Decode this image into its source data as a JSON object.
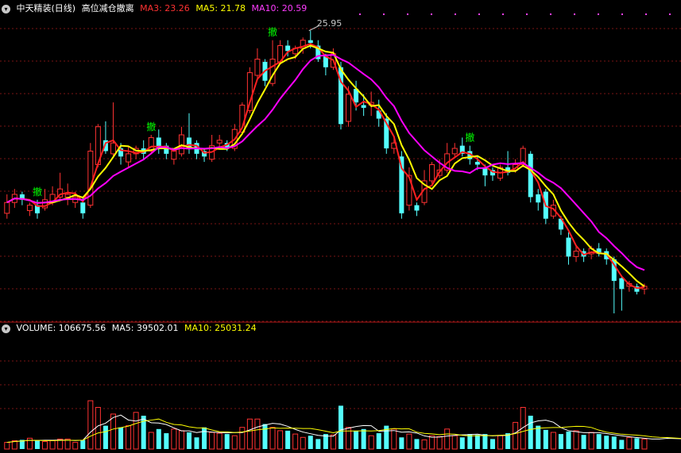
{
  "main_panel": {
    "stock_name": "中天精装(日线)",
    "indicator_name": "高位减仓撤离",
    "ma3_label": "MA3: 23.26",
    "ma5_label": "MA5: 21.78",
    "ma10_label": "MA10: 20.59",
    "high_marker": "25.95",
    "signal_label": "撤"
  },
  "volume_panel": {
    "volume_label": "VOLUME: 106675.56",
    "ma5_label": "MA5: 39502.01",
    "ma10_label": "MA10: 25031.24"
  },
  "colors": {
    "up": "#ff3232",
    "down": "#54ffff",
    "ma3": "#ff2020",
    "ma5": "#ffff00",
    "ma10": "#ff00ff",
    "grid": "#7a1515",
    "signal": "#00ff00",
    "vol_ma": "#ffffff"
  },
  "chart_data": {
    "type": "candlestick",
    "price_ylim": [
      15.5,
      26.5
    ],
    "signal_indices": [
      4,
      19,
      35,
      61
    ],
    "high_marker_index": 40,
    "candles": [
      {
        "o": 19.2,
        "c": 19.6,
        "h": 19.9,
        "l": 19.0
      },
      {
        "o": 19.6,
        "c": 19.9,
        "h": 20.1,
        "l": 19.4
      },
      {
        "o": 19.9,
        "c": 19.7,
        "h": 20.0,
        "l": 19.5
      },
      {
        "o": 19.3,
        "c": 19.5,
        "h": 19.6,
        "l": 19.1
      },
      {
        "o": 19.5,
        "c": 19.2,
        "h": 19.7,
        "l": 19.0
      },
      {
        "o": 19.4,
        "c": 19.7,
        "h": 20.1,
        "l": 19.3
      },
      {
        "o": 19.6,
        "c": 19.9,
        "h": 20.2,
        "l": 19.5
      },
      {
        "o": 19.8,
        "c": 20.1,
        "h": 20.7,
        "l": 19.7
      },
      {
        "o": 19.8,
        "c": 19.9,
        "h": 20.3,
        "l": 19.5
      },
      {
        "o": 19.6,
        "c": 19.8,
        "h": 20.0,
        "l": 19.4
      },
      {
        "o": 19.6,
        "c": 19.2,
        "h": 19.8,
        "l": 19.0
      },
      {
        "o": 19.5,
        "c": 21.5,
        "h": 21.8,
        "l": 19.4
      },
      {
        "o": 21.0,
        "c": 22.4,
        "h": 22.5,
        "l": 20.9
      },
      {
        "o": 21.9,
        "c": 21.5,
        "h": 22.6,
        "l": 21.4
      },
      {
        "o": 21.4,
        "c": 21.8,
        "h": 23.3,
        "l": 21.3
      },
      {
        "o": 21.6,
        "c": 21.3,
        "h": 21.8,
        "l": 21.0
      },
      {
        "o": 21.1,
        "c": 21.4,
        "h": 21.7,
        "l": 20.9
      },
      {
        "o": 21.4,
        "c": 21.6,
        "h": 21.7,
        "l": 21.2
      },
      {
        "o": 21.6,
        "c": 21.4,
        "h": 21.9,
        "l": 21.2
      },
      {
        "o": 21.5,
        "c": 22.0,
        "h": 22.1,
        "l": 21.4
      },
      {
        "o": 22.0,
        "c": 21.6,
        "h": 22.3,
        "l": 21.4
      },
      {
        "o": 21.7,
        "c": 21.4,
        "h": 21.8,
        "l": 21.2
      },
      {
        "o": 21.2,
        "c": 21.5,
        "h": 21.6,
        "l": 21.0
      },
      {
        "o": 21.4,
        "c": 22.1,
        "h": 22.4,
        "l": 21.3
      },
      {
        "o": 22.0,
        "c": 21.6,
        "h": 22.9,
        "l": 21.4
      },
      {
        "o": 21.8,
        "c": 21.4,
        "h": 21.9,
        "l": 21.2
      },
      {
        "o": 21.5,
        "c": 21.3,
        "h": 21.6,
        "l": 21.1
      },
      {
        "o": 21.2,
        "c": 21.7,
        "h": 22.1,
        "l": 21.1
      },
      {
        "o": 21.8,
        "c": 21.9,
        "h": 22.1,
        "l": 21.6
      },
      {
        "o": 21.8,
        "c": 21.6,
        "h": 21.9,
        "l": 21.5
      },
      {
        "o": 21.6,
        "c": 22.3,
        "h": 22.5,
        "l": 21.5
      },
      {
        "o": 22.2,
        "c": 23.2,
        "h": 23.3,
        "l": 22.1
      },
      {
        "o": 23.0,
        "c": 24.4,
        "h": 24.6,
        "l": 22.9
      },
      {
        "o": 24.3,
        "c": 24.9,
        "h": 25.3,
        "l": 24.2
      },
      {
        "o": 24.8,
        "c": 24.1,
        "h": 24.9,
        "l": 23.9
      },
      {
        "o": 24.0,
        "c": 24.9,
        "h": 25.6,
        "l": 23.9
      },
      {
        "o": 24.8,
        "c": 25.4,
        "h": 25.6,
        "l": 24.7
      },
      {
        "o": 25.4,
        "c": 25.2,
        "h": 25.6,
        "l": 25.0
      },
      {
        "o": 25.1,
        "c": 25.3,
        "h": 25.4,
        "l": 24.9
      },
      {
        "o": 25.3,
        "c": 25.6,
        "h": 25.7,
        "l": 25.1
      },
      {
        "o": 25.6,
        "c": 25.5,
        "h": 25.95,
        "l": 25.3
      },
      {
        "o": 25.4,
        "c": 24.9,
        "h": 25.6,
        "l": 24.8
      },
      {
        "o": 25.0,
        "c": 24.6,
        "h": 25.1,
        "l": 24.3
      },
      {
        "o": 24.6,
        "c": 25.1,
        "h": 25.3,
        "l": 24.5
      },
      {
        "o": 24.6,
        "c": 22.5,
        "h": 24.8,
        "l": 22.3
      },
      {
        "o": 22.6,
        "c": 23.6,
        "h": 23.9,
        "l": 22.4
      },
      {
        "o": 23.8,
        "c": 23.3,
        "h": 24.1,
        "l": 23.0
      },
      {
        "o": 23.2,
        "c": 23.1,
        "h": 23.6,
        "l": 22.8
      },
      {
        "o": 23.2,
        "c": 23.3,
        "h": 23.7,
        "l": 22.8
      },
      {
        "o": 23.0,
        "c": 22.7,
        "h": 23.4,
        "l": 22.4
      },
      {
        "o": 22.7,
        "c": 21.6,
        "h": 22.9,
        "l": 21.4
      },
      {
        "o": 21.6,
        "c": 21.8,
        "h": 22.0,
        "l": 21.4
      },
      {
        "o": 21.3,
        "c": 19.2,
        "h": 21.5,
        "l": 19.0
      },
      {
        "o": 19.5,
        "c": 20.6,
        "h": 20.9,
        "l": 19.3
      },
      {
        "o": 19.5,
        "c": 19.3,
        "h": 19.6,
        "l": 19.1
      },
      {
        "o": 19.6,
        "c": 20.4,
        "h": 20.8,
        "l": 19.5
      },
      {
        "o": 20.4,
        "c": 21.0,
        "h": 21.1,
        "l": 20.3
      },
      {
        "o": 20.6,
        "c": 20.8,
        "h": 21.2,
        "l": 20.5
      },
      {
        "o": 20.8,
        "c": 21.4,
        "h": 21.8,
        "l": 20.7
      },
      {
        "o": 21.4,
        "c": 21.6,
        "h": 21.8,
        "l": 21.3
      },
      {
        "o": 21.7,
        "c": 21.4,
        "h": 22.0,
        "l": 21.3
      },
      {
        "o": 21.5,
        "c": 21.2,
        "h": 21.7,
        "l": 21.0
      },
      {
        "o": 21.1,
        "c": 21.0,
        "h": 21.3,
        "l": 20.8
      },
      {
        "o": 20.9,
        "c": 20.6,
        "h": 21.0,
        "l": 20.2
      },
      {
        "o": 20.8,
        "c": 20.6,
        "h": 20.9,
        "l": 20.4
      },
      {
        "o": 20.5,
        "c": 20.9,
        "h": 21.0,
        "l": 20.4
      },
      {
        "o": 20.9,
        "c": 20.7,
        "h": 21.5,
        "l": 20.6
      },
      {
        "o": 20.8,
        "c": 21.0,
        "h": 21.2,
        "l": 20.7
      },
      {
        "o": 21.0,
        "c": 21.6,
        "h": 21.7,
        "l": 20.9
      },
      {
        "o": 21.4,
        "c": 19.8,
        "h": 21.5,
        "l": 19.6
      },
      {
        "o": 19.9,
        "c": 19.6,
        "h": 20.1,
        "l": 19.3
      },
      {
        "o": 20.0,
        "c": 19.0,
        "h": 20.1,
        "l": 18.8
      },
      {
        "o": 19.1,
        "c": 19.5,
        "h": 19.7,
        "l": 19.0
      },
      {
        "o": 19.0,
        "c": 18.6,
        "h": 19.1,
        "l": 18.4
      },
      {
        "o": 18.3,
        "c": 17.6,
        "h": 18.5,
        "l": 17.3
      },
      {
        "o": 17.6,
        "c": 17.8,
        "h": 18.0,
        "l": 17.4
      },
      {
        "o": 17.8,
        "c": 17.6,
        "h": 17.9,
        "l": 17.4
      },
      {
        "o": 17.7,
        "c": 17.9,
        "h": 18.0,
        "l": 17.5
      },
      {
        "o": 17.9,
        "c": 17.7,
        "h": 18.1,
        "l": 17.6
      },
      {
        "o": 17.8,
        "c": 17.5,
        "h": 17.9,
        "l": 17.3
      },
      {
        "o": 17.5,
        "c": 16.7,
        "h": 17.6,
        "l": 15.5
      },
      {
        "o": 16.8,
        "c": 16.4,
        "h": 16.9,
        "l": 15.6
      },
      {
        "o": 16.5,
        "c": 16.6,
        "h": 16.7,
        "l": 16.3
      },
      {
        "o": 16.5,
        "c": 16.3,
        "h": 16.6,
        "l": 16.2
      },
      {
        "o": 16.4,
        "c": 16.5,
        "h": 16.6,
        "l": 16.2
      }
    ],
    "volume_ylim": [
      0,
      60000
    ],
    "volumes": [
      4000,
      5000,
      5500,
      6500,
      5000,
      4500,
      5000,
      6000,
      6000,
      4000,
      5500,
      29000,
      25000,
      14000,
      21000,
      13000,
      14000,
      22000,
      20000,
      10000,
      12000,
      9500,
      12000,
      11000,
      10000,
      7000,
      13000,
      10000,
      9500,
      9000,
      8000,
      13000,
      18000,
      18000,
      15000,
      13000,
      11000,
      11000,
      9000,
      7000,
      8000,
      6000,
      9000,
      8500,
      26000,
      13000,
      11000,
      12000,
      8000,
      9500,
      14000,
      12000,
      7000,
      9000,
      6000,
      5500,
      8000,
      7500,
      12000,
      8000,
      7000,
      9000,
      8500,
      9000,
      6000,
      8000,
      9500,
      16000,
      25000,
      20000,
      14000,
      11500,
      10000,
      9000,
      10500,
      11000,
      8500,
      10000,
      9000,
      8000,
      7500,
      5500,
      7000,
      6500,
      6000,
      5000,
      5500,
      9000,
      6000,
      5500
    ]
  }
}
